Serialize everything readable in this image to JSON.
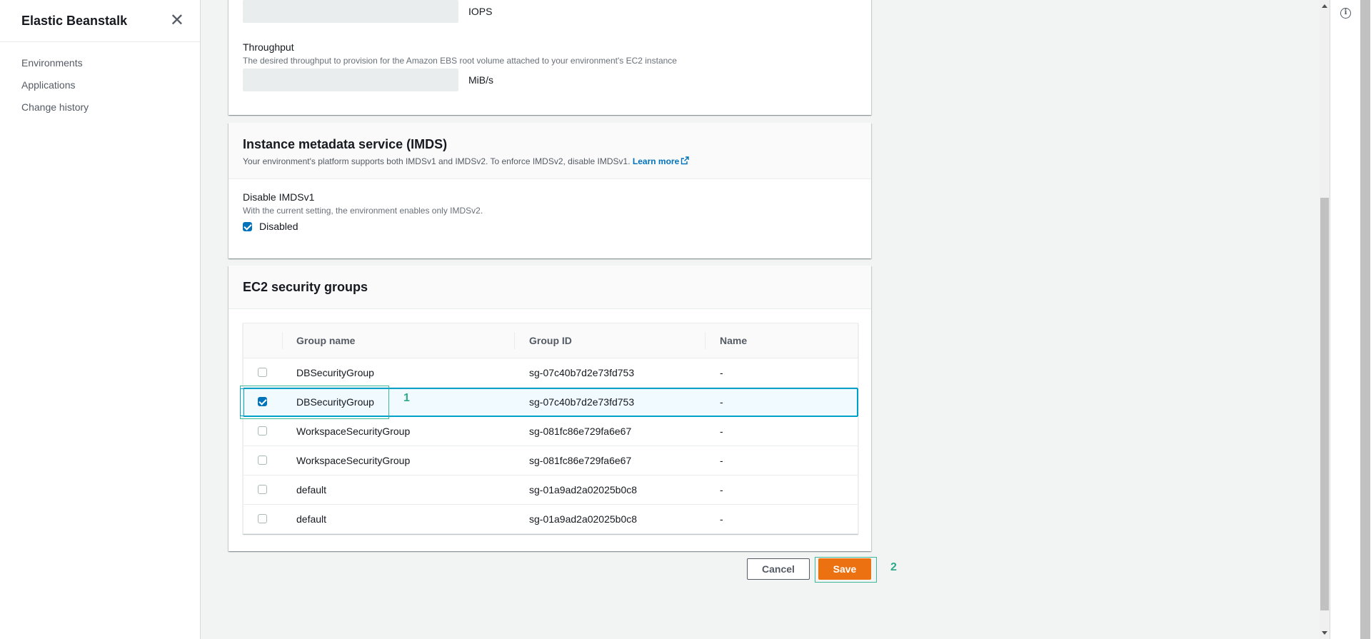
{
  "sidebar": {
    "title": "Elastic Beanstalk",
    "close_icon": "close-icon",
    "items": [
      {
        "label": "Environments"
      },
      {
        "label": "Applications"
      },
      {
        "label": "Change history"
      }
    ]
  },
  "storage": {
    "iops_value": "",
    "iops_unit": "IOPS",
    "throughput_label": "Throughput",
    "throughput_desc": "The desired throughput to provision for the Amazon EBS root volume attached to your environment's EC2 instance",
    "throughput_value": "",
    "throughput_unit": "MiB/s"
  },
  "imds": {
    "title": "Instance metadata service (IMDS)",
    "description": "Your environment's platform supports both IMDSv1 and IMDSv2. To enforce IMDSv2, disable IMDSv1.",
    "learn_more": "Learn more",
    "field_label": "Disable IMDSv1",
    "field_desc": "With the current setting, the environment enables only IMDSv2.",
    "checkbox_label": "Disabled",
    "checked": true
  },
  "security_groups": {
    "title": "EC2 security groups",
    "columns": [
      "Group name",
      "Group ID",
      "Name"
    ],
    "rows": [
      {
        "group_name": "DBSecurityGroup",
        "group_id": "sg-07c40b7d2e73fd753",
        "name": "-",
        "checked": false
      },
      {
        "group_name": "DBSecurityGroup",
        "group_id": "sg-07c40b7d2e73fd753",
        "name": "-",
        "checked": true
      },
      {
        "group_name": "WorkspaceSecurityGroup",
        "group_id": "sg-081fc86e729fa6e67",
        "name": "-",
        "checked": false
      },
      {
        "group_name": "WorkspaceSecurityGroup",
        "group_id": "sg-081fc86e729fa6e67",
        "name": "-",
        "checked": false
      },
      {
        "group_name": "default",
        "group_id": "sg-01a9ad2a02025b0c8",
        "name": "-",
        "checked": false
      },
      {
        "group_name": "default",
        "group_id": "sg-01a9ad2a02025b0c8",
        "name": "-",
        "checked": false
      }
    ]
  },
  "actions": {
    "cancel_label": "Cancel",
    "save_label": "Save"
  },
  "annotations": {
    "one": "1",
    "two": "2"
  },
  "colors": {
    "primary_button": "#ec7211",
    "link": "#0073bb",
    "checkbox_checked": "#0073bb",
    "annotation": "#2eaa8a"
  }
}
